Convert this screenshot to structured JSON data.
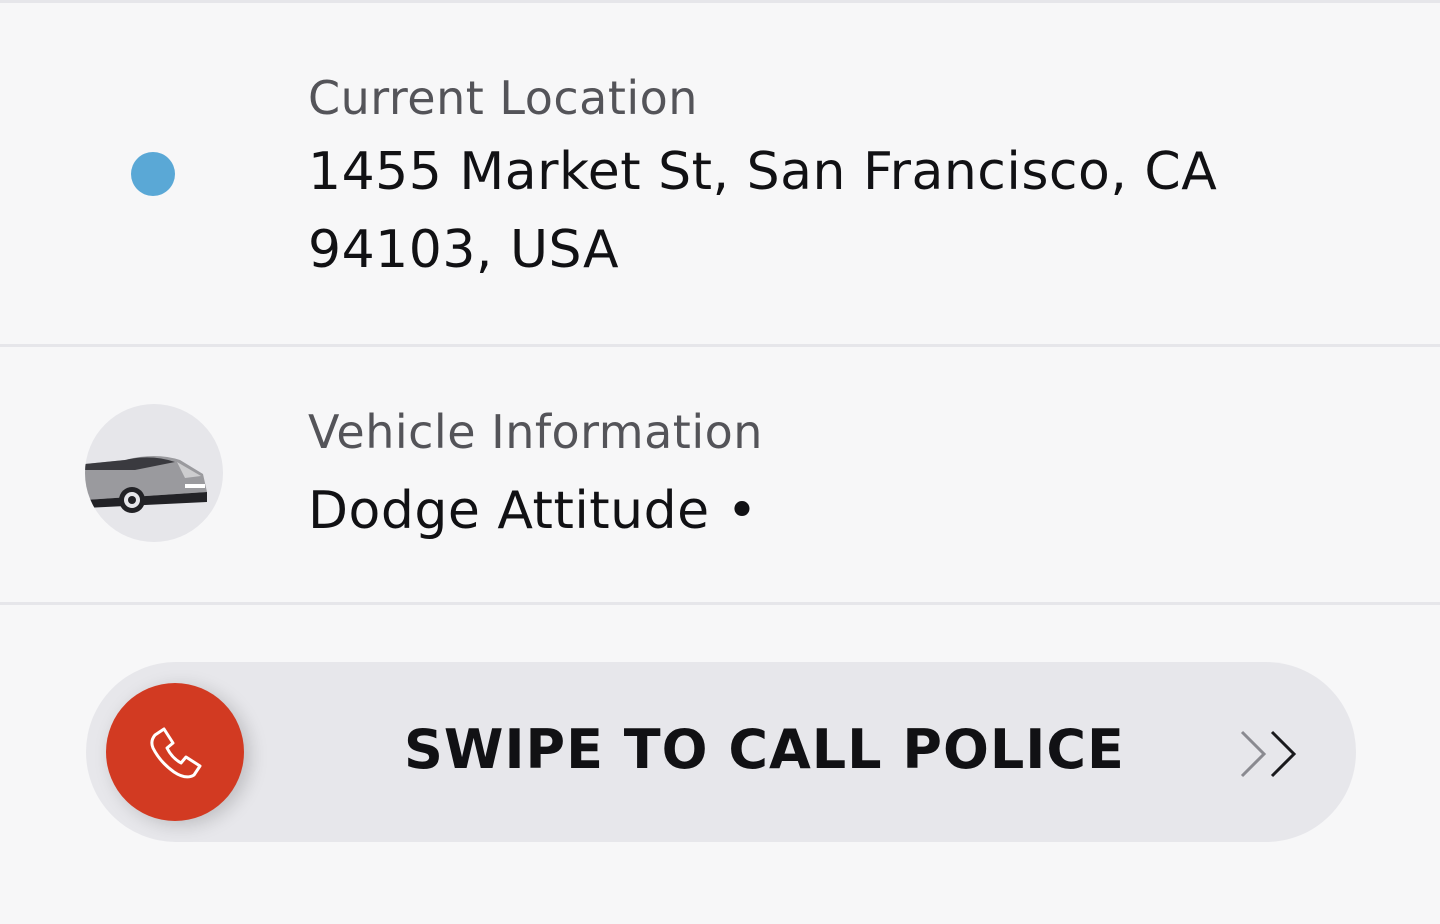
{
  "location": {
    "label": "Current Location",
    "address_line1": "1455 Market St, San Francisco, CA",
    "address_line2": "94103, USA",
    "dot_color": "#5aa8d6"
  },
  "vehicle": {
    "label": "Vehicle Information",
    "value": "Dodge Attitude •",
    "icon": "car-icon"
  },
  "emergency": {
    "action_label": "SWIPE TO CALL POLICE",
    "knob_color": "#d23a22",
    "knob_icon": "phone-icon",
    "hint_icon": "double-chevron-right-icon"
  }
}
